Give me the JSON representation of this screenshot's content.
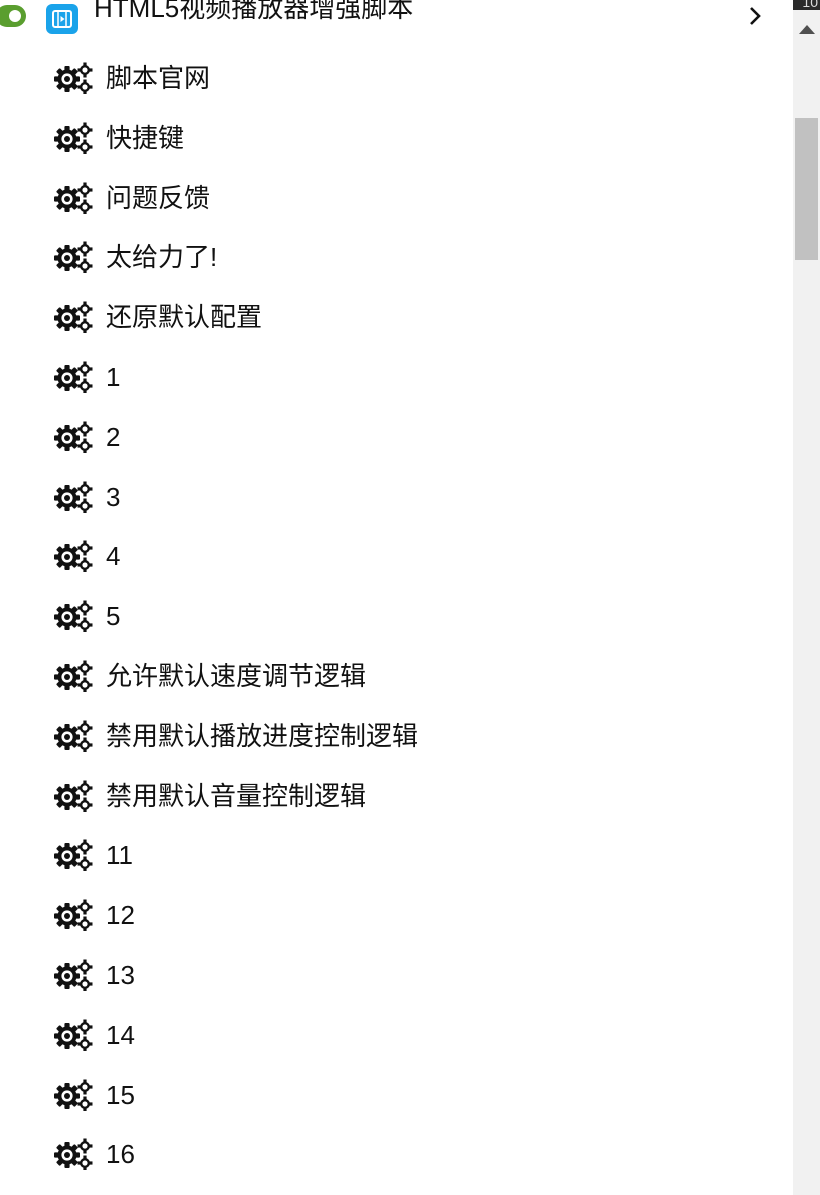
{
  "window": {
    "corner_text": "10"
  },
  "script": {
    "title": "HTML5视频播放器增强脚本",
    "enabled": true,
    "icon": "video-player-icon",
    "accent_color": "#1aa3ea",
    "toggle_color": "#5a9e2f"
  },
  "menu": {
    "item_icon": "gears-icon",
    "items": [
      {
        "label": "脚本官网"
      },
      {
        "label": "快捷键"
      },
      {
        "label": "问题反馈"
      },
      {
        "label": "太给力了!"
      },
      {
        "label": "还原默认配置"
      },
      {
        "label": "1"
      },
      {
        "label": "2"
      },
      {
        "label": "3"
      },
      {
        "label": "4"
      },
      {
        "label": "5"
      },
      {
        "label": "允许默认速度调节逻辑"
      },
      {
        "label": "禁用默认播放进度控制逻辑"
      },
      {
        "label": "禁用默认音量控制逻辑"
      },
      {
        "label": "11"
      },
      {
        "label": "12"
      },
      {
        "label": "13"
      },
      {
        "label": "14"
      },
      {
        "label": "15"
      },
      {
        "label": "16"
      }
    ]
  }
}
